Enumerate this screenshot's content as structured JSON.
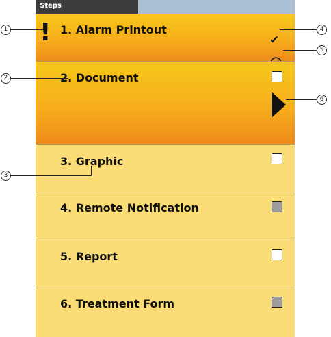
{
  "panel": {
    "title": "Steps"
  },
  "steps": [
    {
      "number": 1,
      "label": "1. Alarm Printout",
      "status": "completed",
      "checkbox": "checkmark",
      "icon": "exclamation-icon"
    },
    {
      "number": 2,
      "label": "2. Document",
      "status": "current",
      "checkbox": "empty",
      "icon": "current-step-arrow-icon"
    },
    {
      "number": 3,
      "label": "3. Graphic",
      "status": "open",
      "checkbox": "empty"
    },
    {
      "number": 4,
      "label": "4. Remote Notification",
      "status": "open",
      "checkbox": "partial"
    },
    {
      "number": 5,
      "label": "5. Report",
      "status": "open",
      "checkbox": "empty"
    },
    {
      "number": 6,
      "label": "6. Treatment Form",
      "status": "open",
      "checkbox": "partial"
    }
  ],
  "callouts": [
    "1",
    "2",
    "3",
    "4",
    "5",
    "6"
  ],
  "colors": {
    "active_gradient_top": "#f6c81a",
    "active_gradient_bottom": "#ee8a1c",
    "inactive": "#fbdd78",
    "header": "#a9bfd4",
    "header_tab": "#3d3d3d"
  }
}
